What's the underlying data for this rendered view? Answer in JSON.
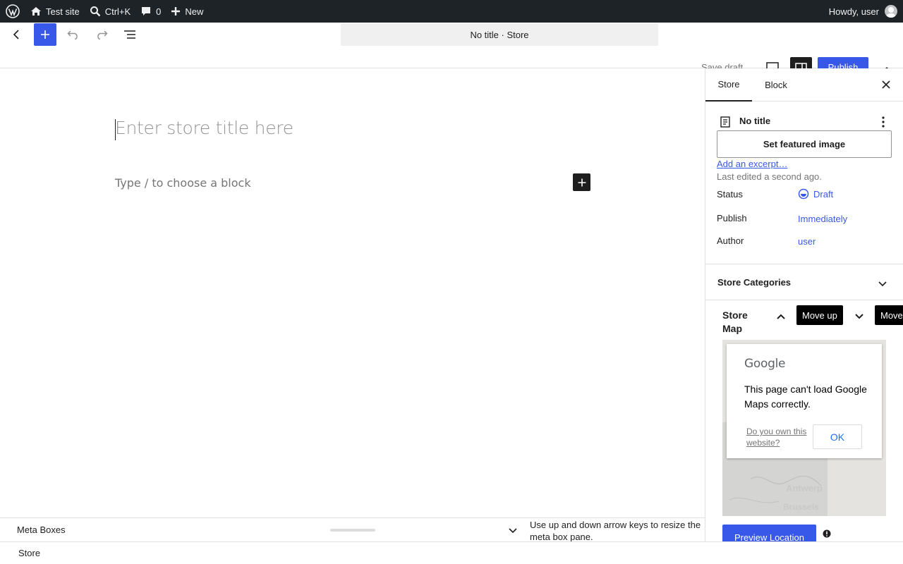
{
  "adminbar": {
    "site_name": "Test site",
    "search_shortcut": "Ctrl+K",
    "comments_count": "0",
    "new_label": "New",
    "greeting": "Howdy, user"
  },
  "header": {
    "document_title": "No title · Store",
    "save_draft_label": "Save draft",
    "publish_label": "Publish"
  },
  "canvas": {
    "title_placeholder": "Enter store title here",
    "block_placeholder": "Type / to choose a block"
  },
  "sidebar": {
    "tabs": [
      {
        "label": "Store"
      },
      {
        "label": "Block"
      }
    ],
    "post_title": "No title",
    "featured_image_label": "Set featured image",
    "excerpt_link": "Add an excerpt…",
    "last_edited": "Last edited a second ago.",
    "rows": {
      "status": {
        "label": "Status",
        "value": "Draft"
      },
      "publish": {
        "label": "Publish",
        "value": "Immediately"
      },
      "author": {
        "label": "Author",
        "value": "user"
      }
    },
    "categories_panel": {
      "title": "Store Categories"
    },
    "map_panel": {
      "title": "Store Map",
      "move_up_tooltip": "Move up",
      "move_down_tooltip": "Move",
      "map_error": {
        "brand": "Google",
        "message": "This page can't load Google Maps correctly.",
        "own_link": "Do you own this website?",
        "ok_label": "OK"
      },
      "map_labels": [
        "Antwerp",
        "Brussels"
      ],
      "preview_button": "Preview Location"
    }
  },
  "meta_boxes": {
    "title": "Meta Boxes",
    "help_text": "Use up and down arrow keys to resize the meta box pane."
  },
  "footer": {
    "breadcrumb": "Store"
  },
  "colors": {
    "accent": "#3858e9",
    "admin_bar": "#1d2327"
  }
}
